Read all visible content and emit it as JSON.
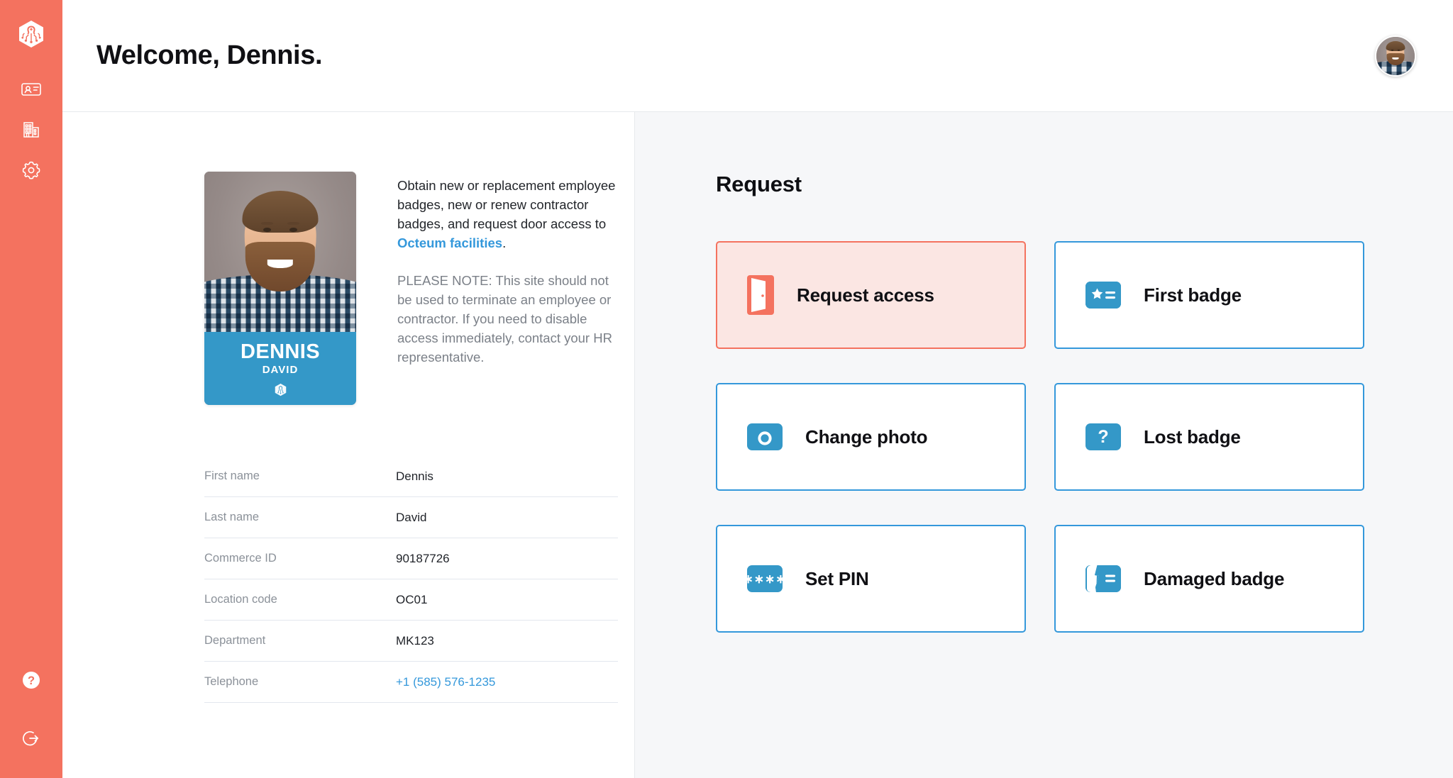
{
  "brand": {
    "accent_coral": "#f4725f",
    "accent_blue": "#3498db",
    "badge_blue": "#3498c8",
    "highlight_bg": "#fbe6e3",
    "panel_bg": "#f6f7f9"
  },
  "sidebar": {
    "logo": {
      "name": "octeum-logo-icon"
    },
    "items": [
      {
        "icon": "id-card-icon",
        "label": "Badges"
      },
      {
        "icon": "building-icon",
        "label": "Facilities"
      },
      {
        "icon": "gear-icon",
        "label": "Settings"
      }
    ],
    "bottom_items": [
      {
        "icon": "help-circle-icon",
        "label": "Help"
      },
      {
        "icon": "logout-icon",
        "label": "Log out"
      }
    ]
  },
  "header": {
    "title": "Welcome, Dennis.",
    "avatar_alt": "Dennis David"
  },
  "profile": {
    "badge": {
      "first_name": "DENNIS",
      "last_name": "DAVID",
      "logo_icon": "octeum-logo-icon"
    },
    "description": {
      "primary_prefix": "Obtain new or replacement employee badges, new or renew contractor badges, and request door access to ",
      "primary_link": "Octeum facilities",
      "primary_suffix": ".",
      "note": "PLEASE NOTE: This site should not be used to terminate an employee or contractor. If you need to disable access immediately, contact your HR representative."
    },
    "fields": [
      {
        "label": "First name",
        "value": "Dennis",
        "is_link": false
      },
      {
        "label": "Last name",
        "value": "David",
        "is_link": false
      },
      {
        "label": "Commerce ID",
        "value": "90187726",
        "is_link": false
      },
      {
        "label": "Location code",
        "value": "OC01",
        "is_link": false
      },
      {
        "label": "Department",
        "value": "MK123",
        "is_link": false
      },
      {
        "label": "Telephone",
        "value": "+1 (585) 576-1235",
        "is_link": true
      }
    ]
  },
  "request": {
    "title": "Request",
    "cards": [
      {
        "label": "Request access",
        "icon": "door-open-icon",
        "highlighted": true
      },
      {
        "label": "First badge",
        "icon": "badge-star-icon",
        "highlighted": false
      },
      {
        "label": "Change photo",
        "icon": "camera-icon",
        "highlighted": false
      },
      {
        "label": "Lost badge",
        "icon": "question-mark-icon",
        "highlighted": false
      },
      {
        "label": "Set PIN",
        "icon": "asterisks-icon",
        "highlighted": false,
        "pin_mask": "∗∗∗∗"
      },
      {
        "label": "Damaged badge",
        "icon": "badge-cracked-icon",
        "highlighted": false
      }
    ]
  }
}
